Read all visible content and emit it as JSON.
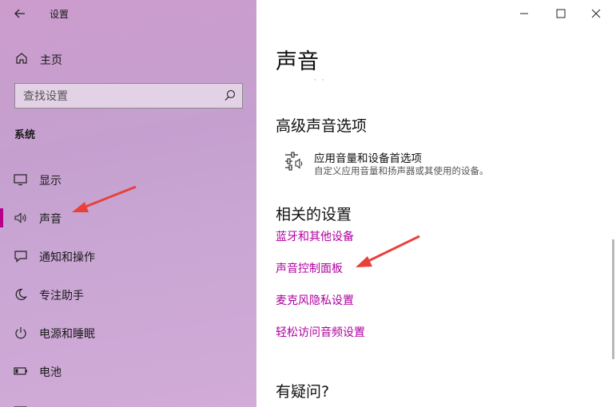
{
  "app": {
    "title": "设置"
  },
  "sidebar": {
    "home_label": "主页",
    "search_placeholder": "查找设置",
    "section": "系统",
    "items": [
      {
        "label": "显示",
        "icon": "monitor-icon"
      },
      {
        "label": "声音",
        "icon": "speaker-icon",
        "active": true
      },
      {
        "label": "通知和操作",
        "icon": "notification-icon"
      },
      {
        "label": "专注助手",
        "icon": "moon-icon"
      },
      {
        "label": "电源和睡眠",
        "icon": "power-icon"
      },
      {
        "label": "电池",
        "icon": "battery-icon"
      }
    ]
  },
  "content": {
    "title": "声音",
    "advanced": {
      "heading": "高级声音选项",
      "item_title": "应用音量和设备首选项",
      "item_desc": "自定义应用音量和扬声器或其使用的设备。"
    },
    "related": {
      "heading": "相关的设置",
      "links": [
        "蓝牙和其他设备",
        "声音控制面板",
        "麦克风隐私设置",
        "轻松访问音频设置"
      ]
    },
    "help_heading": "有疑问?"
  },
  "colors": {
    "accent": "#b000a0",
    "active_bar": "#b6008c",
    "arrow": "#e8413c"
  }
}
